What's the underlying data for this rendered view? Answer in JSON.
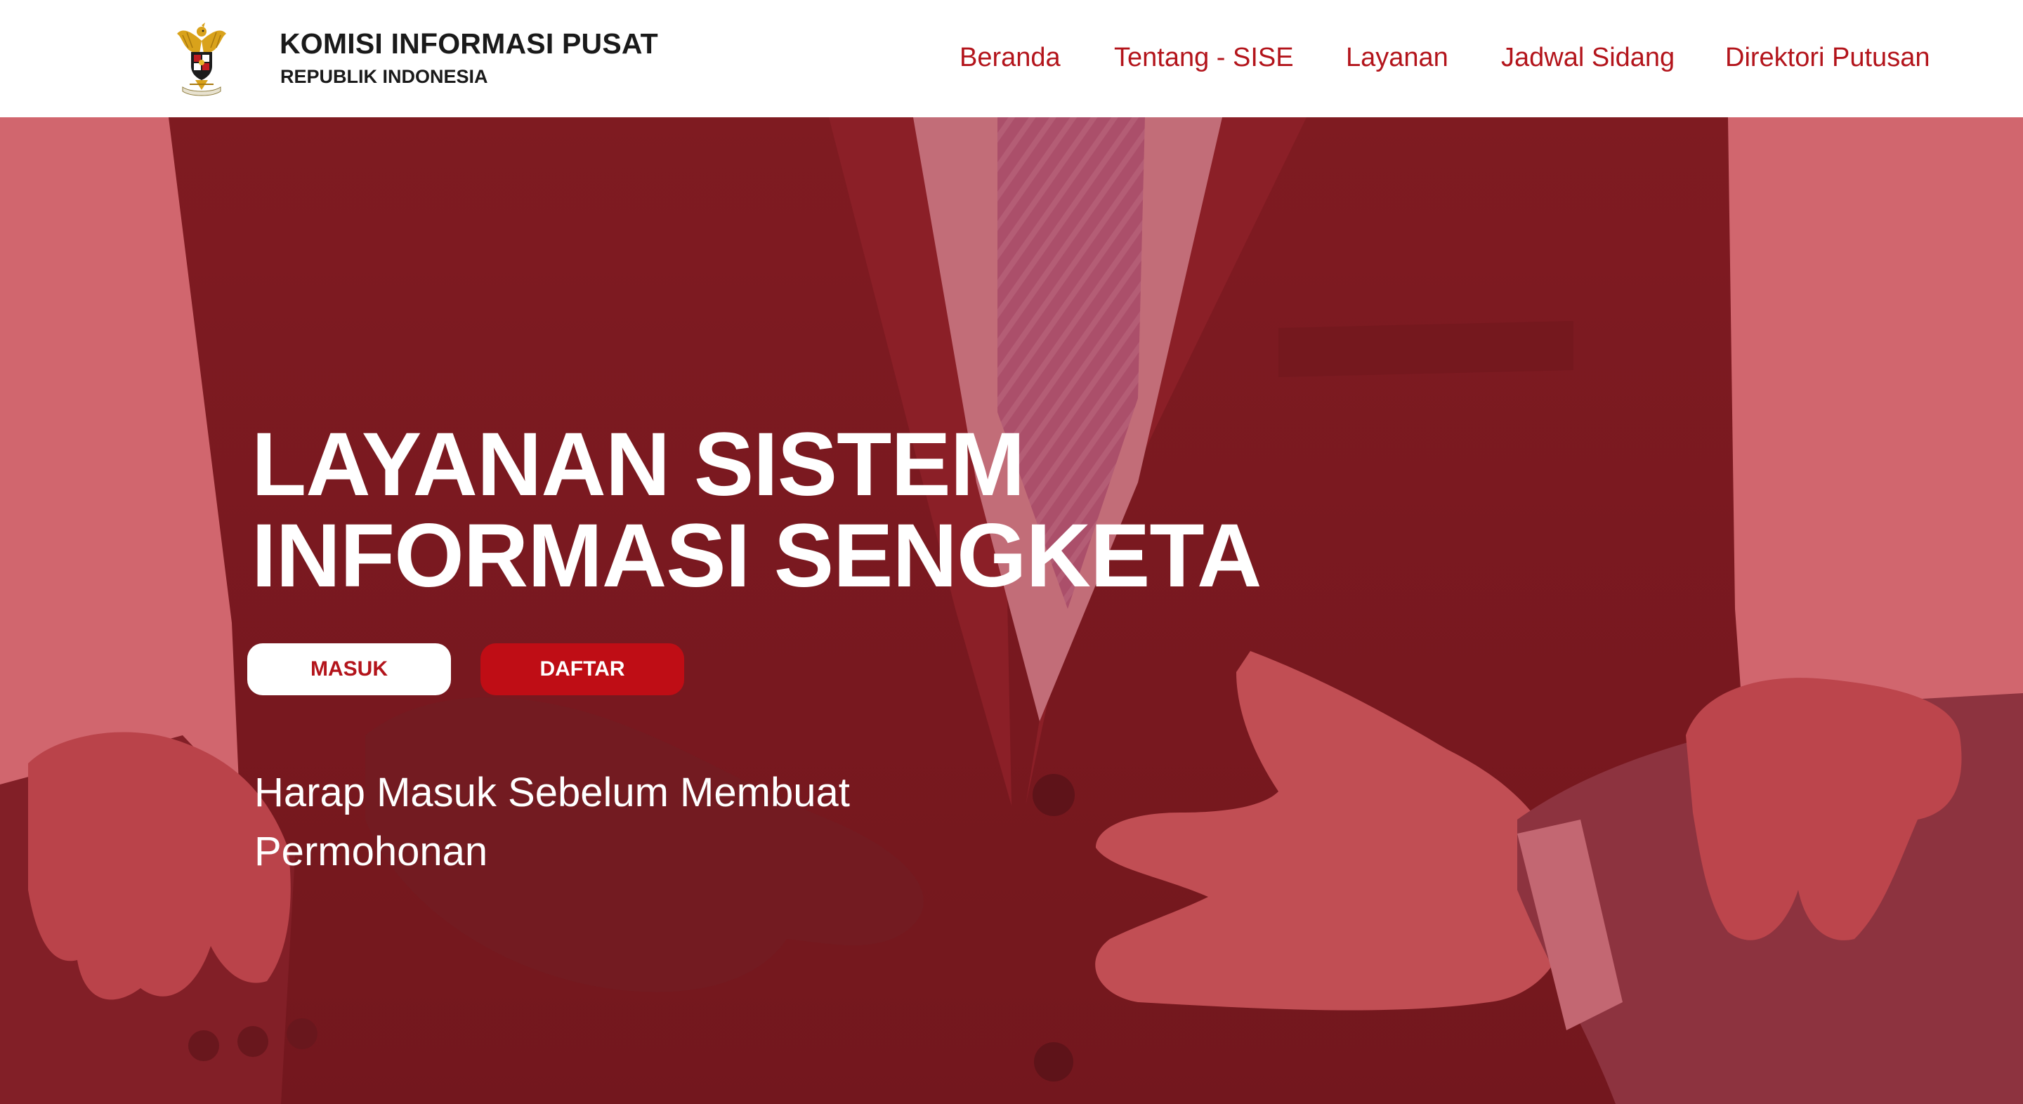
{
  "brand": {
    "name": "KOMISI INFORMASI PUSAT",
    "subtitle": "REPUBLIK INDONESIA"
  },
  "nav": {
    "items": [
      {
        "label": "Beranda"
      },
      {
        "label": "Tentang - SISE"
      },
      {
        "label": "Layanan"
      },
      {
        "label": "Jadwal Sidang"
      },
      {
        "label": "Direktori Putusan"
      }
    ]
  },
  "hero": {
    "title_line1": "LAYANAN SISTEM",
    "title_line2": "INFORMASI SENGKETA",
    "masuk_label": "MASUK",
    "daftar_label": "DAFTAR",
    "note": "Harap Masuk Sebelum Membuat Permohonan"
  },
  "colors": {
    "accent": "#b3141b",
    "button_red": "#bf0d15",
    "overlay": "#c0313a",
    "header_bg": "#ffffff",
    "text_dark": "#1a1a1a"
  },
  "icons": {
    "logo": "garuda-emblem-icon"
  }
}
